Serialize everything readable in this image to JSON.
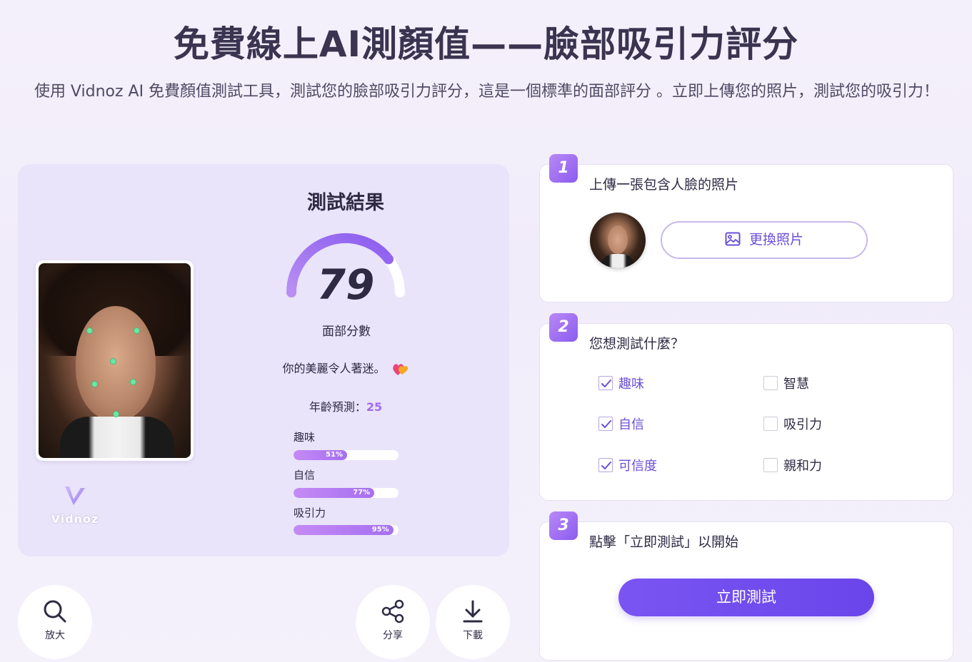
{
  "header": {
    "title": "免費線上AI測顏值——臉部吸引力評分",
    "subtitle": "使用 Vidnoz AI 免費顏值測試工具，測試您的臉部吸引力評分，這是一個標準的面部評分 。立即上傳您的照片，測試您的吸引力！"
  },
  "result": {
    "title": "測試結果",
    "score": "79",
    "score_value": 79,
    "score_label": "面部分數",
    "compliment": "你的美麗令人著迷。",
    "age_label": "年齡預測：",
    "age_value": "25",
    "logo_text": "Vidnoz",
    "metrics": [
      {
        "label": "趣味",
        "value": "51%",
        "percent": 51
      },
      {
        "label": "自信",
        "value": "77%",
        "percent": 77
      },
      {
        "label": "吸引力",
        "value": "95%",
        "percent": 95
      }
    ]
  },
  "actions": {
    "zoom": "放大",
    "share": "分享",
    "download": "下載"
  },
  "steps": {
    "step1": {
      "number": "1",
      "text": "上傳一張包含人臉的照片",
      "button": "更換照片"
    },
    "step2": {
      "number": "2",
      "text": "您想測試什麼？",
      "options": [
        {
          "label": "趣味",
          "checked": true
        },
        {
          "label": "智慧",
          "checked": false
        },
        {
          "label": "自信",
          "checked": true
        },
        {
          "label": "吸引力",
          "checked": false
        },
        {
          "label": "可信度",
          "checked": true
        },
        {
          "label": "親和力",
          "checked": false
        }
      ]
    },
    "step3": {
      "number": "3",
      "text": "點擊「立即測試」以開始",
      "button": "立即測試"
    }
  },
  "colors": {
    "accent": "#6a45ea",
    "gauge_start": "#9a6cf0",
    "gauge_end": "#e6dcf7",
    "landmark": "#6ee7a4"
  }
}
